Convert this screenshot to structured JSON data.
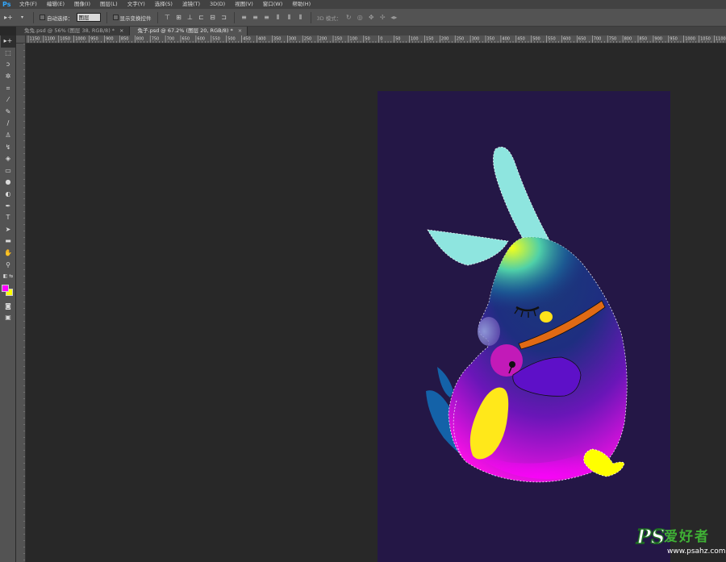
{
  "app": {
    "logo": "Ps"
  },
  "menu": [
    "文件(F)",
    "编辑(E)",
    "图像(I)",
    "图层(L)",
    "文字(Y)",
    "选择(S)",
    "滤镜(T)",
    "3D(D)",
    "视图(V)",
    "窗口(W)",
    "帮助(H)"
  ],
  "options_bar": {
    "auto_select_label": "自动选择：",
    "auto_select_value": "图层",
    "show_transform_label": "显示变换控件",
    "mode_3d_label": "3D 模式："
  },
  "tabs": [
    {
      "label": "兔兔.psd @ 56% (图层 38, RGB/8) *",
      "close": "×"
    },
    {
      "label": "兔子.psd @ 67.2% (图层 20, RGB/8) *",
      "close": "×"
    }
  ],
  "ruler_top_labels": [
    "1150",
    "1100",
    "1050",
    "1000",
    "950",
    "900",
    "850",
    "800",
    "750",
    "700",
    "650",
    "600",
    "550",
    "500",
    "450",
    "400",
    "350",
    "300",
    "250",
    "200",
    "150",
    "100",
    "50",
    "0",
    "50",
    "100",
    "150",
    "200",
    "250",
    "300",
    "350",
    "400",
    "450",
    "500",
    "550",
    "600",
    "650",
    "700",
    "750",
    "800",
    "850",
    "900",
    "950",
    "1000",
    "1050",
    "1100"
  ],
  "colors": {
    "foreground": "#ff00ff",
    "background": "#ffff00",
    "canvas": "#241746",
    "workspace": "#282828"
  },
  "tools": [
    "move-tool-icon",
    "marquee-tool-icon",
    "lasso-tool-icon",
    "magic-wand-icon",
    "crop-tool-icon",
    "eyedropper-icon",
    "healing-brush-icon",
    "brush-tool-icon",
    "clone-stamp-icon",
    "history-brush-icon",
    "eraser-icon",
    "gradient-tool-icon",
    "blur-tool-icon",
    "dodge-tool-icon",
    "pen-tool-icon",
    "type-tool-icon",
    "path-selection-icon",
    "rectangle-tool-icon",
    "hand-tool-icon",
    "zoom-tool-icon"
  ],
  "watermark": {
    "ps": "PS",
    "cn": "爱好者",
    "url": "www.psahz.com"
  }
}
